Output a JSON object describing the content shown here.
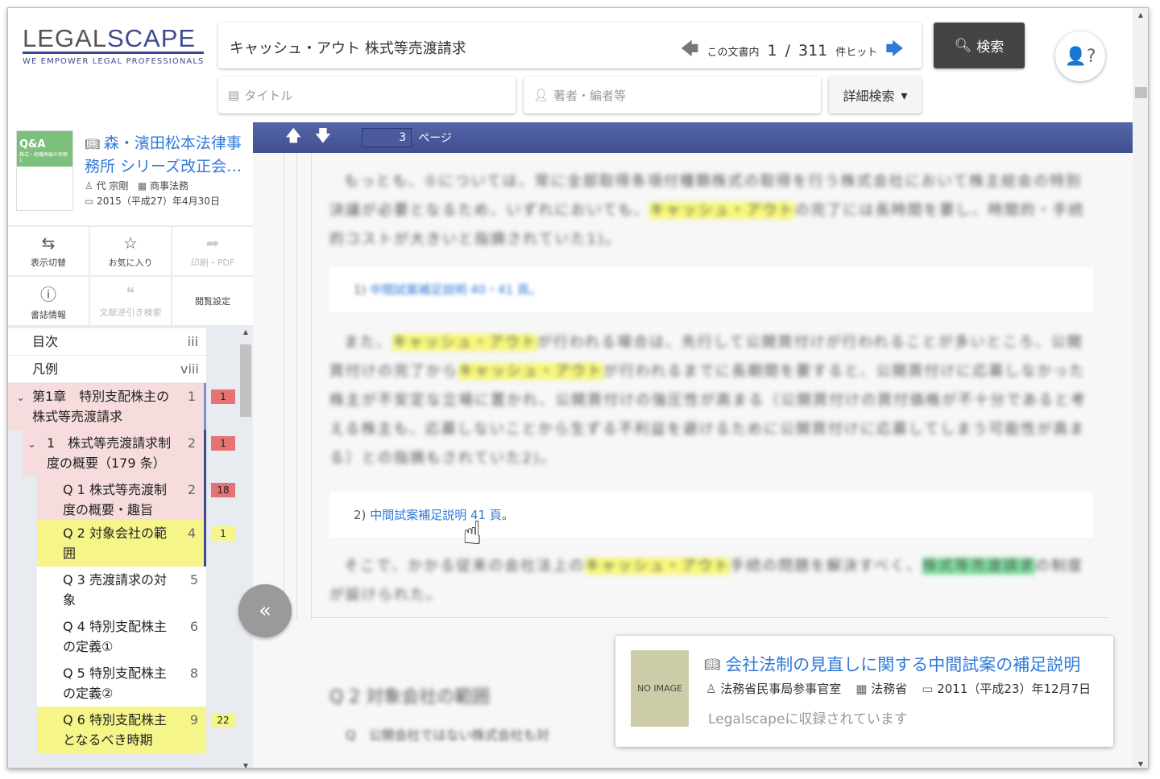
{
  "logo": {
    "name": "LEGALSCAPE",
    "tagline": "WE EMPOWER LEGAL PROFESSIONALS"
  },
  "search": {
    "query": "キャッシュ・アウト 株式等売渡請求",
    "hit_prefix": "この文書内",
    "hit_current": "1",
    "hit_sep": "/",
    "hit_total": "311",
    "hit_suffix": "件ヒット",
    "button": "検索",
    "title_placeholder": "タイトル",
    "author_placeholder": "著者・編者等",
    "advanced": "詳細検索"
  },
  "book": {
    "title": "森・濱田松本法律事務所 シリーズ改正会…",
    "author": "代 宗剛",
    "publisher": "商事法務",
    "date": "2015（平成27）年4月30日",
    "cover_text": "Q&A",
    "cover_sub": "株式・組織再編の実務1"
  },
  "actions": [
    {
      "label": "表示切替",
      "icon": "file-swap"
    },
    {
      "label": "お気に入り",
      "icon": "file-star"
    },
    {
      "label": "印刷・PDF",
      "icon": "share"
    },
    {
      "label": "書誌情報",
      "icon": "info"
    },
    {
      "label": "文献逆引き検索",
      "icon": "quote"
    },
    {
      "label": "閲覧設定",
      "icon": ""
    }
  ],
  "toc": [
    {
      "label": "目次",
      "page": "iii"
    },
    {
      "label": "凡例",
      "page": "viii"
    },
    {
      "label": "第1章　特別支配株主の株式等売渡請求",
      "page": "1",
      "hits": "1"
    },
    {
      "label": "1　株式等売渡請求制度の概要（179 条）",
      "page": "2",
      "hits": "1"
    },
    {
      "label": "Q 1 株式等売渡制度の概要・趣旨",
      "page": "2",
      "hits": "18"
    },
    {
      "label": "Q 2 対象会社の範囲",
      "page": "4",
      "hits": "1"
    },
    {
      "label": "Q 3 売渡請求の対象",
      "page": "5"
    },
    {
      "label": "Q 4 特別支配株主の定義①",
      "page": "6"
    },
    {
      "label": "Q 5 特別支配株主の定義②",
      "page": "8"
    },
    {
      "label": "Q 6 特別支配株主となるべき時期",
      "page": "9",
      "hits": "22"
    }
  ],
  "toolbar": {
    "page": "3",
    "page_label": "ページ"
  },
  "content": {
    "p1": [
      "もっとも、①については、常に全部取得条項付種類株式の取得を行う株式会社において株主総会の特別決議が必要となるため、いずれにおいても、",
      "キャッシュ・アウト",
      "の完了には長時間を要し、時間的・手続的コストが大きいと指摘されていた1)。"
    ],
    "fn1_num": "1)",
    "fn1_link": "中間試案補足説明 40・41 頁。",
    "p2": [
      "また、",
      "キャッシュ・アウト",
      "が行われる場合は、先行して公開買付けが行われることが多いところ、公開買付けの完了から",
      "キャッシュ・アウト",
      "が行われるまでに長期間を要すると、公開買付けに応募しなかった株主が不安定な立場に置かれ、公開買付けの強圧性が高まる（公開買付けの買付価格が不十分であると考える株主も、応募しないことから生ずる不利益を避けるために公開買付けに応募してしまう可能性が高まる）との指摘もされていた2)。"
    ],
    "fn2_num": "2)",
    "fn2_link": "中間試案補足説明 41 頁",
    "fn2_end": "。",
    "p3": [
      "そこで、かかる従来の会社法上の",
      "キャッシュ・アウト",
      "手続の問題を解決すべく、",
      "株式等売渡請求",
      "の制度が設けられた。"
    ],
    "heading": "Q 2 対象会社の範囲",
    "question": "Q　公開会社ではない株式会社も対"
  },
  "popup": {
    "no_image": "NO IMAGE",
    "title": "会社法制の見直しに関する中間試案の補足説明",
    "author": "法務省民事局参事官室",
    "publisher": "法務省",
    "date": "2011（平成23）年12月7日",
    "note": "Legalscapeに収録されています"
  },
  "colors": {
    "brand": "#3c4b8f",
    "link": "#2f7ad8",
    "hit_red": "#e57373",
    "hit_yellow": "#f5f58a",
    "toc_red": "#f6dcdc"
  }
}
